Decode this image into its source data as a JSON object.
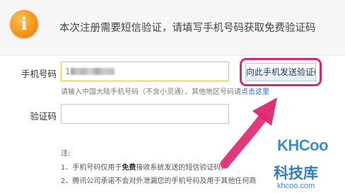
{
  "banner": {
    "icon": "info-icon",
    "text": "本次注册需要短信验证，请填写手机号码获取免费验证码"
  },
  "phone": {
    "label": "手机号码",
    "value": "1",
    "button_label": "向此手机发送验证码"
  },
  "hint": {
    "text": "请输入中国大陆手机号码（不含小灵通），其他地区号码请",
    "link": "点击这里"
  },
  "code": {
    "label": "验证码",
    "value": ""
  },
  "notes": {
    "title": "注:",
    "item1_prefix": "1、手机号码仅用于",
    "item1_bold": "免费",
    "item1_suffix": "接收系统发送的短信验证码。",
    "item2": "2、腾讯公司承诺不会对外泄漏您的手机号码及用于其他任何商"
  },
  "watermark": {
    "brand": "KHCoo",
    "cn": "科技库",
    "domain": "khcoo.com"
  },
  "colors": {
    "highlight": "#e0246e",
    "icon": "#f5961b",
    "link": "#2b6cc4"
  }
}
